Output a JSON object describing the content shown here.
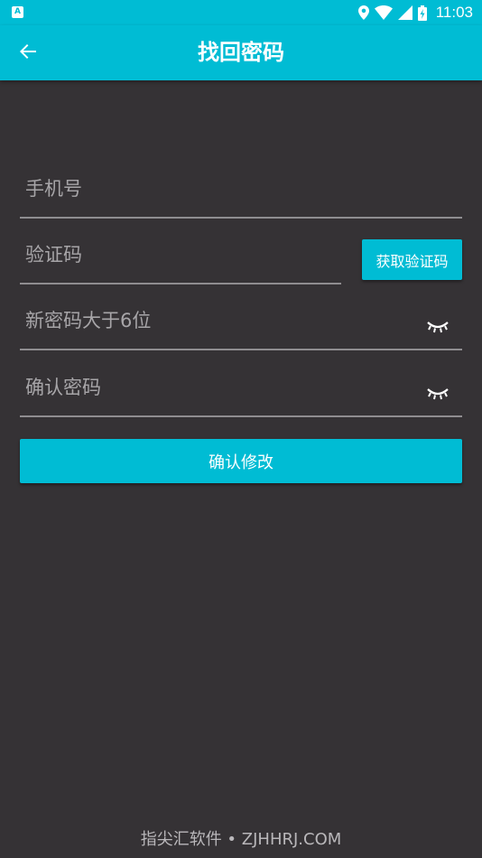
{
  "status_bar": {
    "left_icon_letter": "A",
    "time": "11:03",
    "icons": [
      "location-icon",
      "wifi-icon",
      "signal-icon",
      "battery-icon"
    ]
  },
  "app_bar": {
    "title": "找回密码",
    "back_icon": "arrow-left-icon",
    "background": "#00bcd4"
  },
  "form": {
    "phone_placeholder": "手机号",
    "code_placeholder": "验证码",
    "get_code_label": "获取验证码",
    "new_password_placeholder": "新密码大于6位",
    "confirm_password_placeholder": "确认密码",
    "password_toggle_icon": "eye-closed-icon",
    "submit_label": "确认修改"
  },
  "watermark": "指尖汇软件 • ZJHHRJ.COM",
  "colors": {
    "accent": "#00bcd4",
    "background": "#353235",
    "underline": "#8f8d90",
    "placeholder": "#a7a5a8"
  }
}
